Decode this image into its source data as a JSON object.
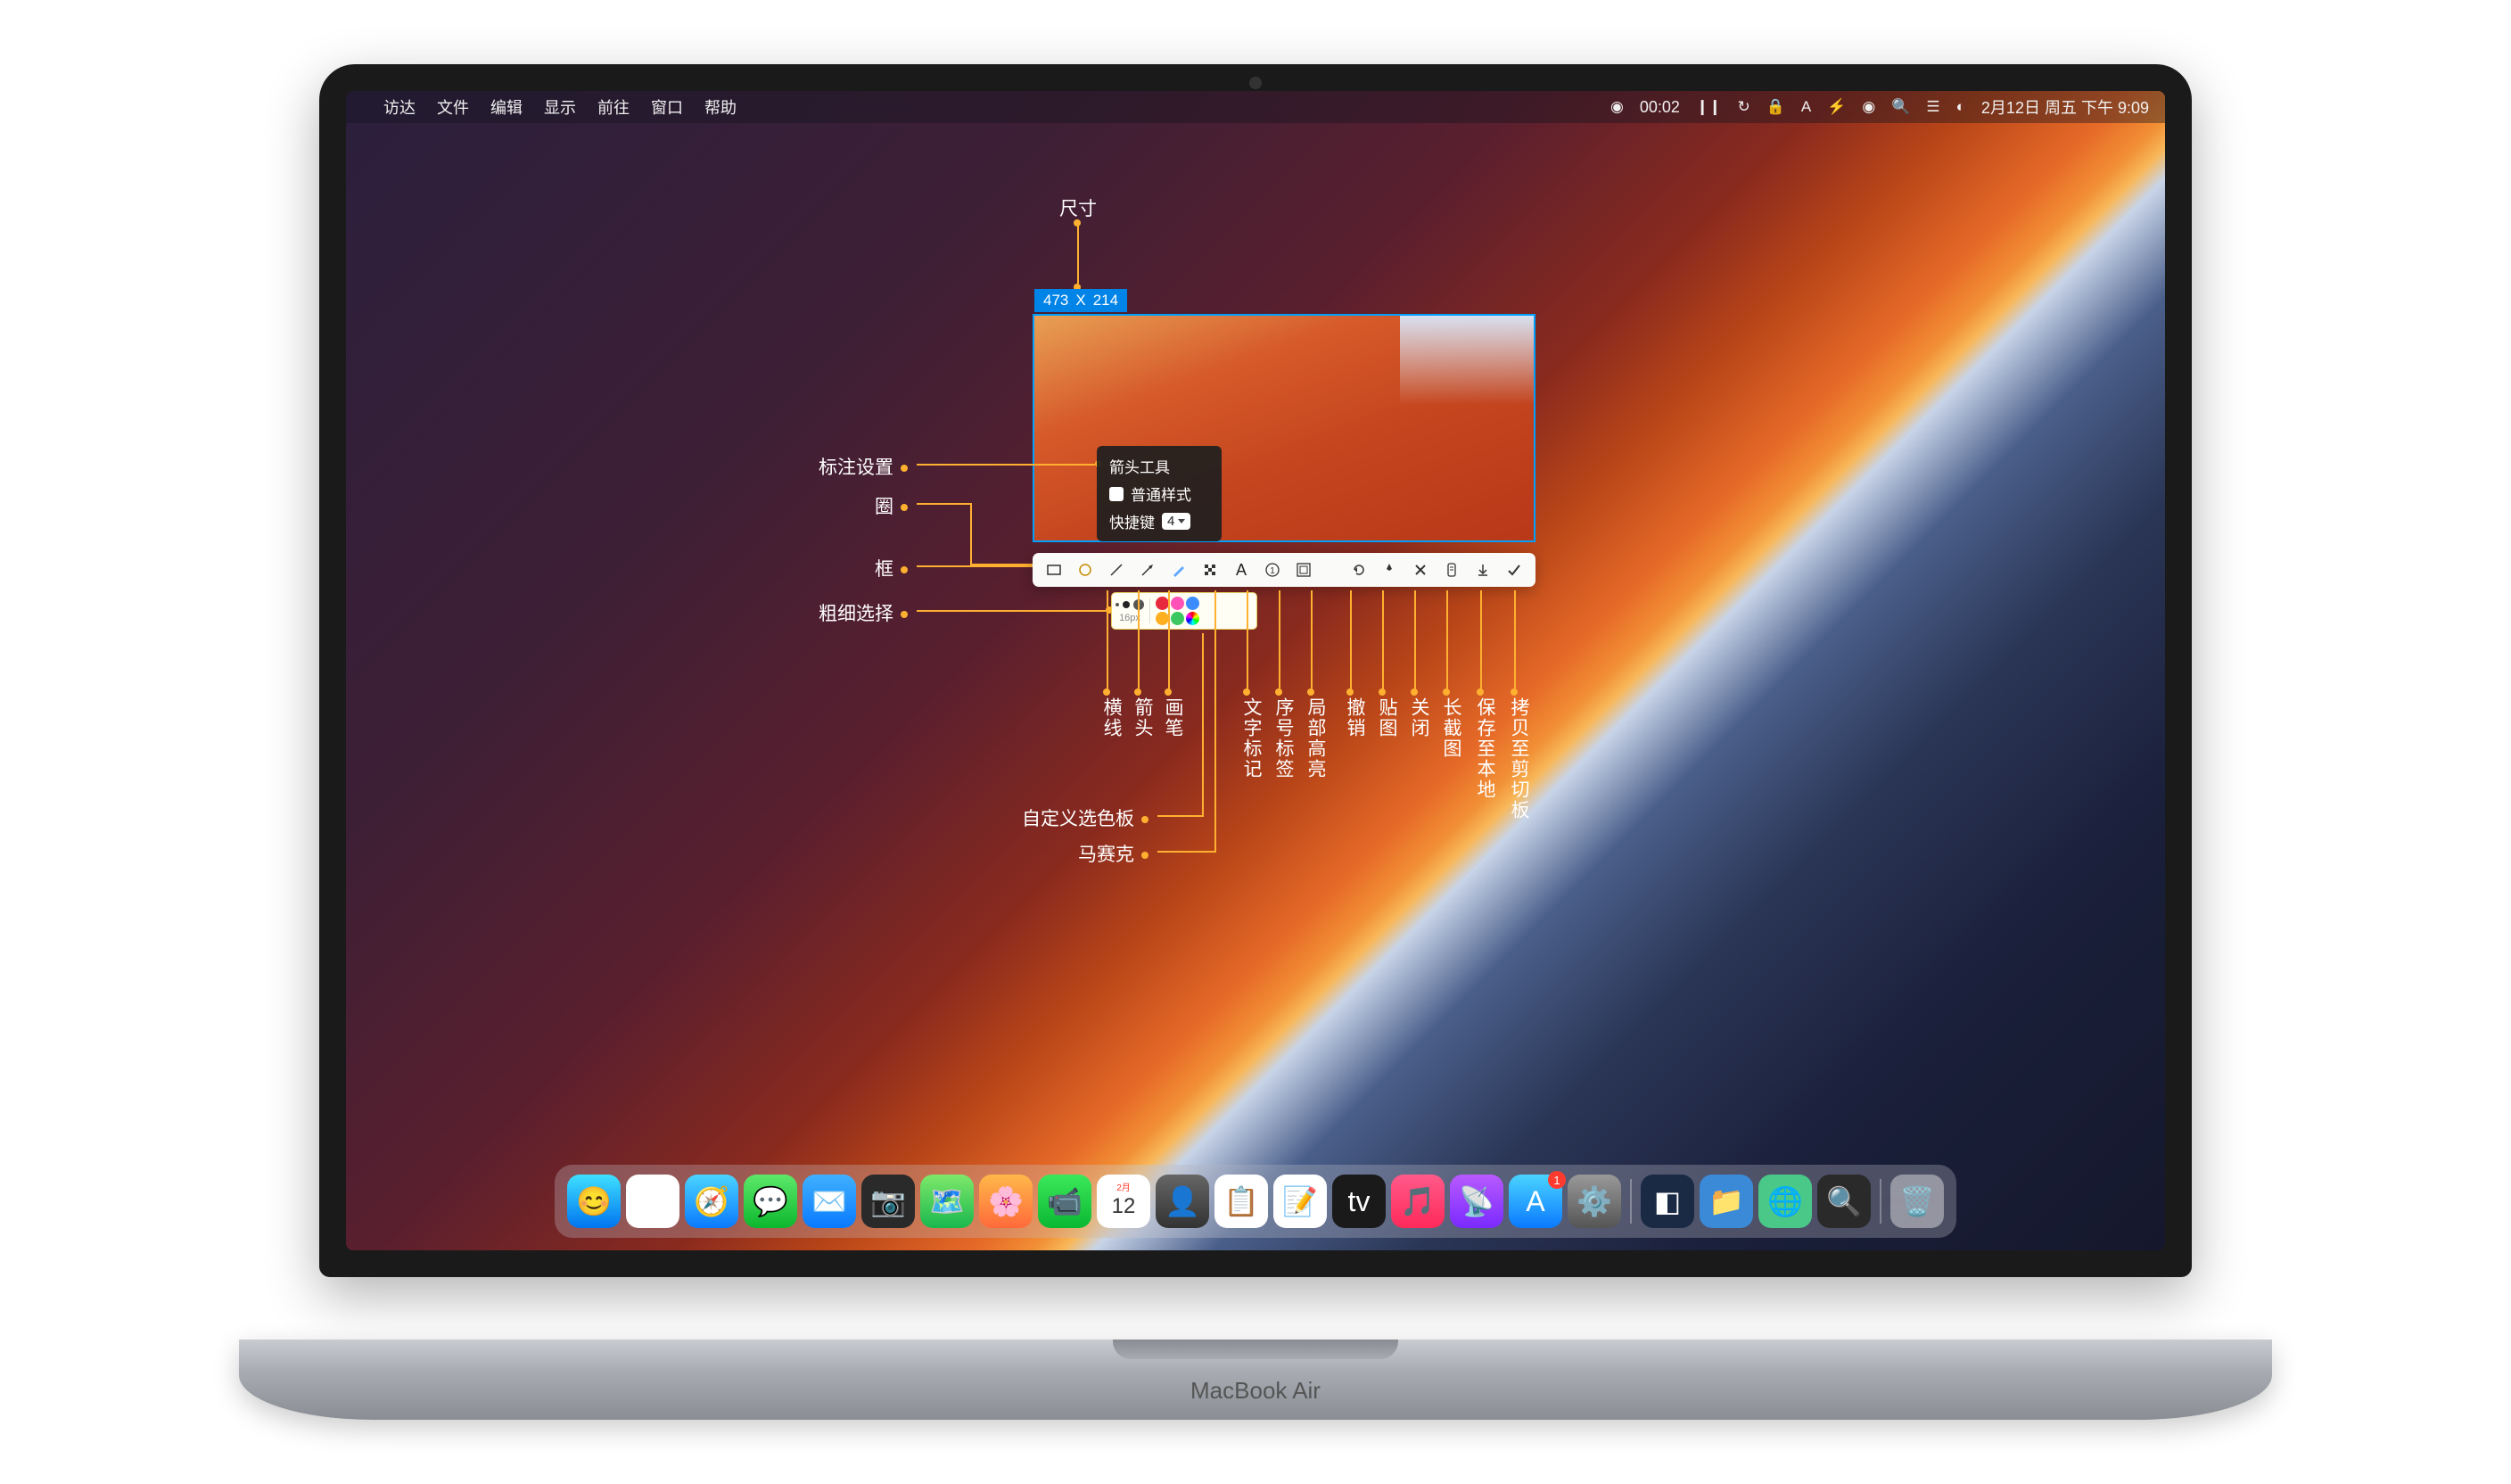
{
  "menubar": {
    "left": [
      "访达",
      "文件",
      "编辑",
      "显示",
      "前往",
      "窗口",
      "帮助"
    ],
    "right": {
      "rec_time": "00:02",
      "date_time": "2月12日 周五 下午 9:09"
    }
  },
  "capture": {
    "size_w": "473",
    "size_sep": "X",
    "size_h": "214"
  },
  "tooltip": {
    "title": "箭头工具",
    "style_label": "普通样式",
    "hotkey_label": "快捷键",
    "hotkey_value": "4"
  },
  "annotations": {
    "top": "尺寸",
    "left1": "标注设置",
    "left2": "圈",
    "left3": "框",
    "left4": "粗细选择",
    "palette": "自定义选色板",
    "mosaic": "马赛克",
    "v1": "横线",
    "v2": "箭头",
    "v3": "画笔",
    "v4": "文字标记",
    "v5": "序号标签",
    "v6": "局部高亮",
    "v7": "撤销",
    "v8": "贴图",
    "v9": "关闭",
    "v10": "长截图",
    "v11": "保存至本地",
    "v12": "拷贝至剪切板"
  },
  "subpanel": {
    "size_label": "16px"
  },
  "laptop_label": "MacBook Air",
  "colors": {
    "accent": "#ffb030",
    "capture_border": "#00a0ff",
    "size_badge": "#0084e8"
  }
}
